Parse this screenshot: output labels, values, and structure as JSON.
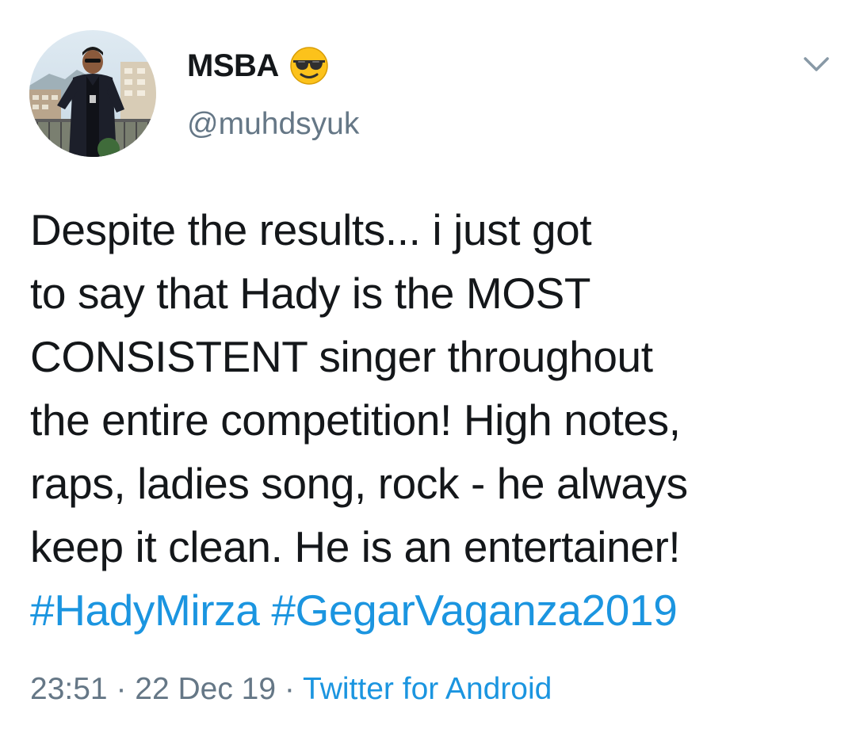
{
  "user": {
    "display_name": "MSBA",
    "emoji_icon": "smiling-face-with-sunglasses",
    "handle": "@muhdsyuk"
  },
  "tweet": {
    "lines": [
      "Despite the results... i just got",
      "to say that Hady is the MOST",
      "CONSISTENT singer throughout",
      "the entire competition! High notes,",
      "raps, ladies song, rock - he always",
      "keep it clean. He is an entertainer!"
    ],
    "hashtags": [
      "#HadyMirza",
      "#GegarVaganza2019"
    ]
  },
  "meta": {
    "time": "23:51",
    "separator": " · ",
    "date": "22 Dec 19",
    "source": "Twitter for Android"
  },
  "colors": {
    "text": "#14171a",
    "secondary": "#657786",
    "link": "#1b95e0"
  }
}
